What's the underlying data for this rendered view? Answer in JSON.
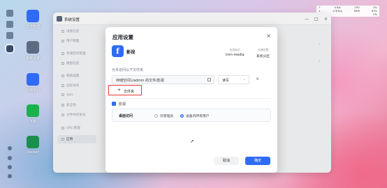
{
  "desktop": {
    "apps": [
      {
        "label": "文件管理",
        "color": "#2f6bf5"
      },
      {
        "label": "系统设置",
        "color": "#5c6b80"
      },
      {
        "label": "应用中心",
        "color": "#2f6bf5"
      },
      {
        "label": "下载",
        "color": "#19b14c"
      },
      {
        "label": "Docker",
        "color": "#1a8f4d"
      }
    ]
  },
  "sysmon": {
    "row1": [
      "↑",
      "0 B/s",
      "CPU",
      "0%"
    ],
    "row2": [
      "↓",
      "278 B/s",
      "RAM",
      "67%"
    ],
    "row3": [
      "",
      "",
      "",
      "0%"
    ]
  },
  "window": {
    "title": "系统设置",
    "sidebar": [
      "设备信息",
      "用户管理",
      "存储空间管理",
      "硬盘信息",
      "网络设置",
      "远程访问",
      "SSH",
      "安全性",
      "文件共享协议",
      "UPS 管理",
      "应用"
    ]
  },
  "modal": {
    "title": "应用设置",
    "app_name": "影视",
    "app_id_label": "应用标识",
    "app_id_value": "trim-media",
    "install_loc_label": "存储位置",
    "install_loc_value": "系统分区",
    "folder_section_label": "允许访问以下文件夹",
    "folder_path": "存储空间1/admin 的文件/影视",
    "permission": "读写",
    "add_folder_label": "文件夹",
    "perm_section_label": "影视",
    "desktop_access_label": "桌面访问",
    "radio_admin": "仅管理员",
    "radio_all": "设备内所有用户",
    "cancel_label": "取消",
    "ok_label": "确定"
  }
}
